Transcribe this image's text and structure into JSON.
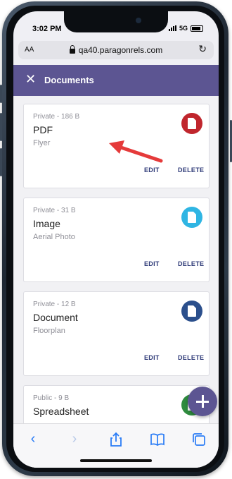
{
  "status_bar": {
    "time": "3:02 PM",
    "network": "5G"
  },
  "browser": {
    "text_size": "AA",
    "url": "qa40.paragonrels.com"
  },
  "header": {
    "title": "Documents"
  },
  "documents": [
    {
      "meta": "Private - 186 B",
      "name": "PDF",
      "description": "Flyer",
      "icon": "pdf-file-icon",
      "icon_color": "#c0262d",
      "edit": "EDIT",
      "delete": "DELETE"
    },
    {
      "meta": "Private - 31 B",
      "name": "Image",
      "description": "Aerial Photo",
      "icon": "image-file-icon",
      "icon_color": "#2fb5e3",
      "edit": "EDIT",
      "delete": "DELETE"
    },
    {
      "meta": "Private - 12 B",
      "name": "Document",
      "description": "Floorplan",
      "icon": "document-file-icon",
      "icon_color": "#2b4f8c",
      "edit": "EDIT",
      "delete": "DELETE"
    },
    {
      "meta": "Public - 9 B",
      "name": "Spreadsheet",
      "description": "",
      "icon": "spreadsheet-file-icon",
      "icon_color": "#2e8b3e",
      "edit": "",
      "delete": ""
    }
  ],
  "colors": {
    "accent": "#5c5592",
    "action_text": "#2f3b78",
    "annotation_arrow": "#e53a3a"
  },
  "toolbar_icons": [
    "back-icon",
    "forward-icon",
    "share-icon",
    "bookmarks-icon",
    "tabs-icon"
  ]
}
